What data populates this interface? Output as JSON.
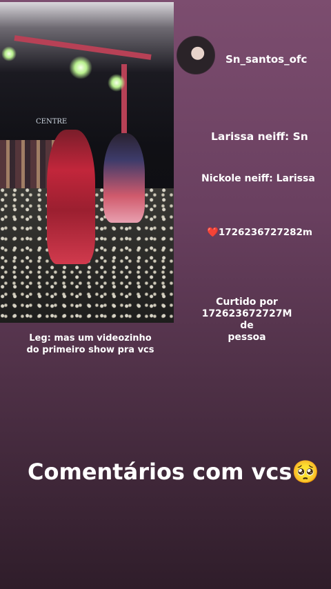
{
  "profile": {
    "username": "Sn_santos_ofc"
  },
  "comments": [
    {
      "text": "Larissa neiff: Sn"
    },
    {
      "text": "Nickole neiff: Larissa"
    }
  ],
  "likes": {
    "heart": "❤️",
    "count_text": "1726236727282m"
  },
  "curtido": {
    "line1": "Curtido por",
    "line2": "172623672727M de",
    "line3": "pessoa"
  },
  "caption": {
    "line1": "Leg: mas um videozinho",
    "line2": "do primeiro show pra vcs"
  },
  "headline": {
    "text": "Comentários com vcs🥺"
  },
  "photo": {
    "sign_text": "CENTRE"
  },
  "colors": {
    "background_top": "#7c4d6f",
    "background_bottom": "#2f1d2a",
    "heart": "#e0263a"
  }
}
